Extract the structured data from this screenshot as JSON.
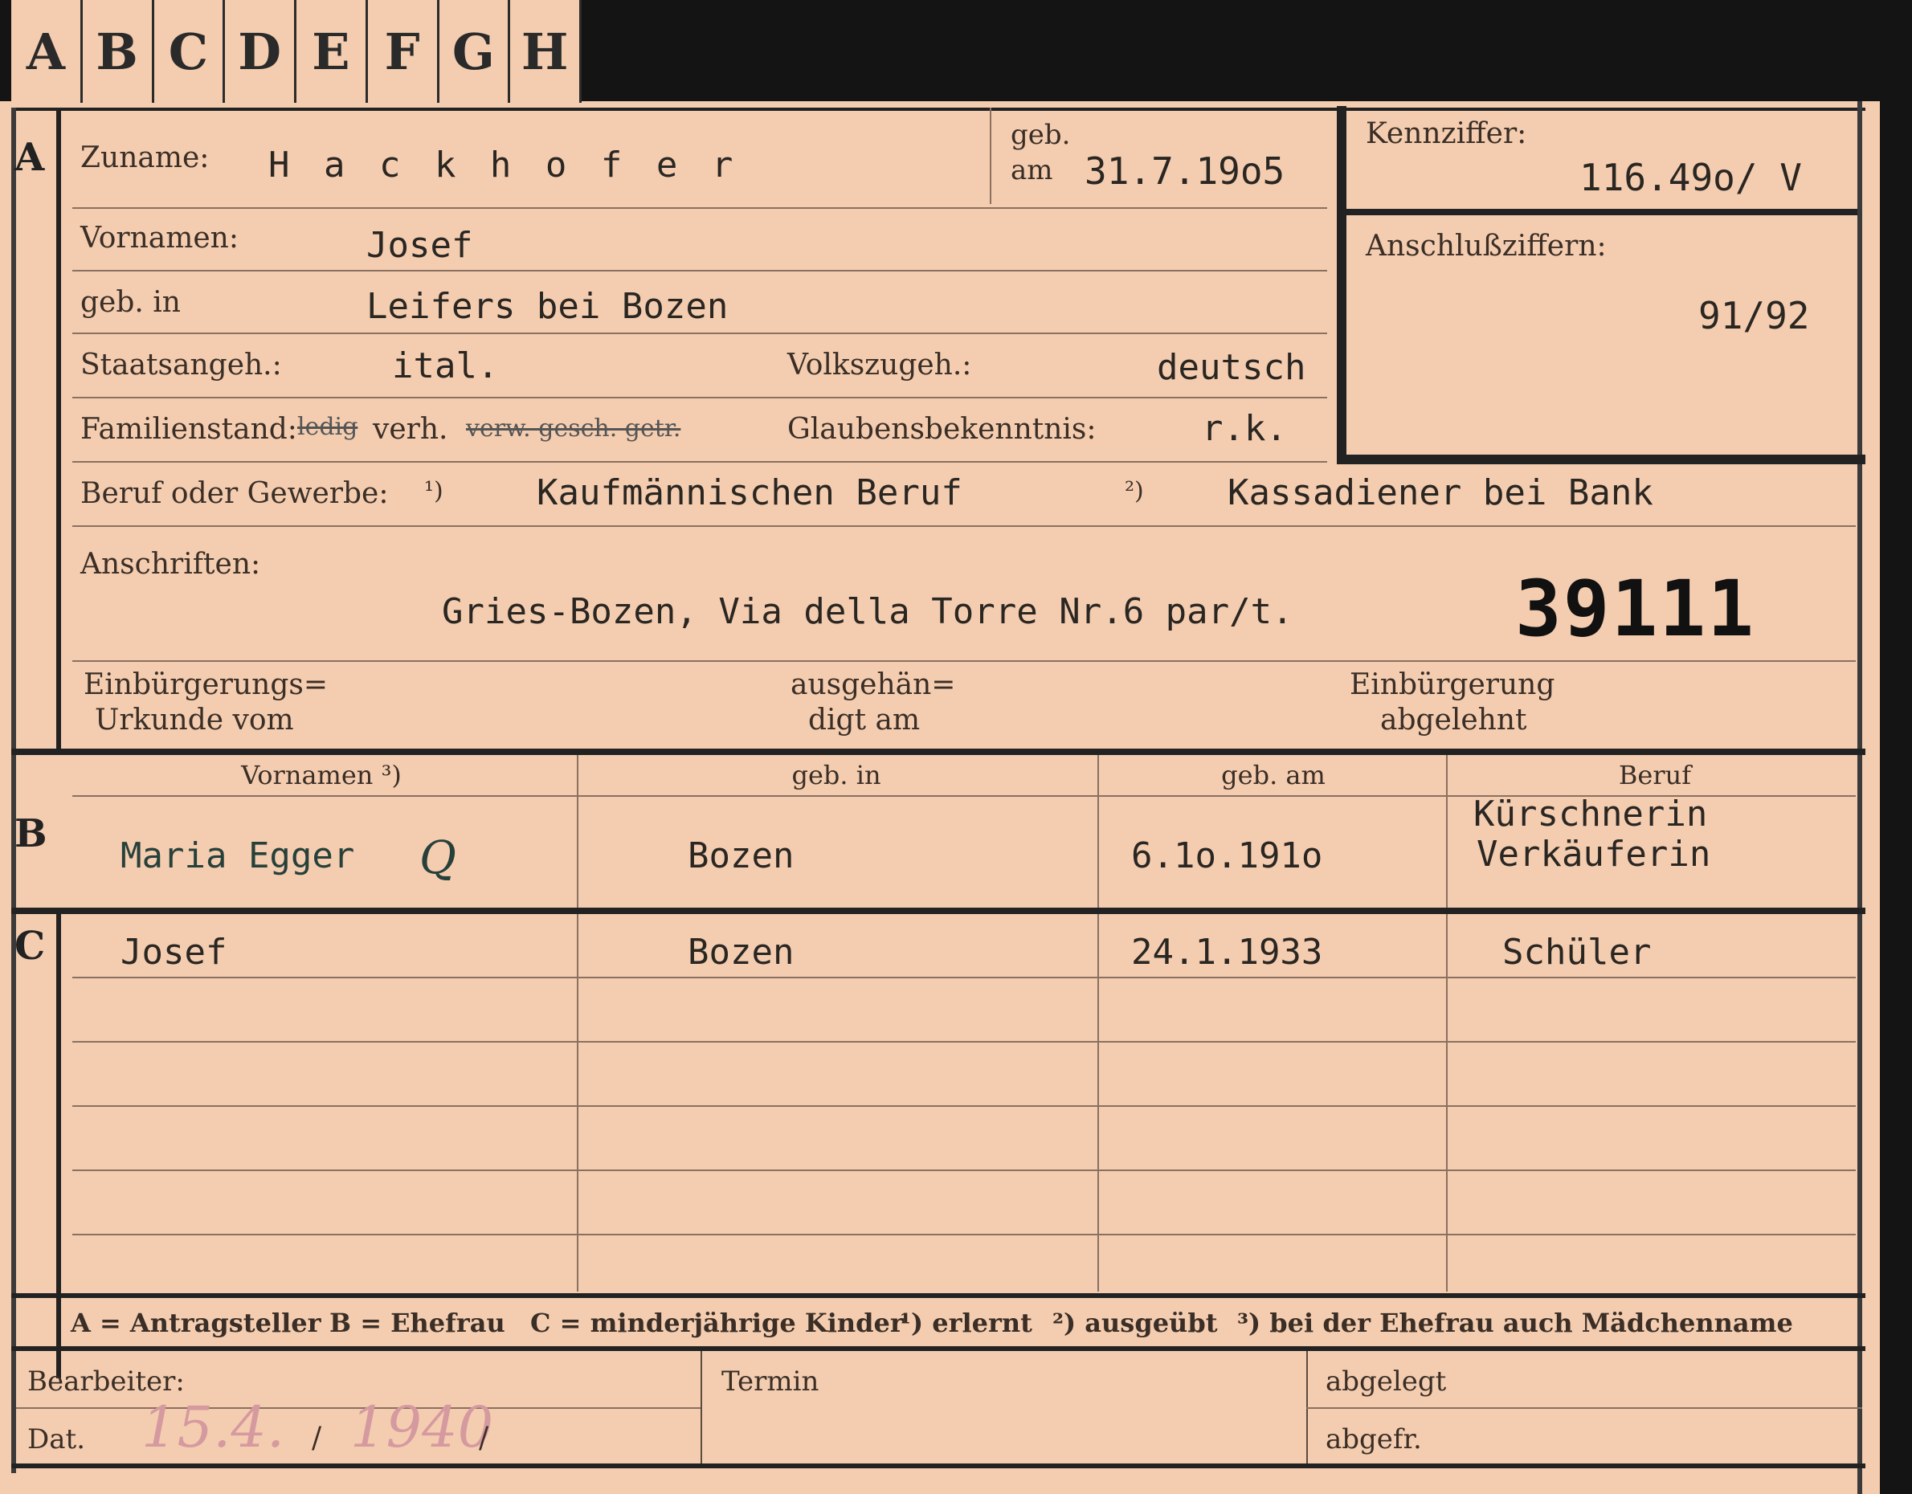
{
  "tabs": [
    "A",
    "B",
    "C",
    "D",
    "E",
    "F",
    "G",
    "H"
  ],
  "section_letters": {
    "a": "A",
    "b": "B",
    "c": "C"
  },
  "applicant": {
    "surname_label": "Zuname:",
    "surname": "H a c k h o f e r",
    "born_label_1": "geb.",
    "born_label_2": "am",
    "born_date": "31.7.19o5",
    "firstname_label": "Vornamen:",
    "firstname": "Josef",
    "birthplace_label": "geb. in",
    "birthplace": "Leifers  bei Bozen",
    "citizenship_label": "Staatsangeh.:",
    "citizenship": "ital.",
    "ethnicity_label": "Volkszugeh.:",
    "ethnicity": "deutsch",
    "marital_label": "Familienstand:",
    "marital_struck_1": "ledig",
    "marital_value": "verh.",
    "marital_struck_2": "verw. gesch. getr.",
    "religion_label": "Glaubensbekenntnis:",
    "religion": "r.k.",
    "profession_label": "Beruf oder Gewerbe:",
    "profession_note_1": "¹)",
    "profession_learned": "Kaufmännischen Beruf",
    "profession_note_2": "²)",
    "profession_practiced": "Kassadiener bei Bank",
    "address_label": "Anschriften:",
    "address": "Gries-Bozen, Via della Torre Nr.6 par/t.",
    "stamp_number": "39111",
    "naturalization_cert_label_1": "Einbürgerungs=",
    "naturalization_cert_label_2": "Urkunde vom",
    "handed_out_label_1": "ausgehän=",
    "handed_out_label_2": "digt am",
    "naturalization_refused_label_1": "Einbürgerung",
    "naturalization_refused_label_2": "abgelehnt"
  },
  "reference": {
    "id_label": "Kennziffer:",
    "id_value": "116.49o/ V",
    "connection_label": "Anschlußziffern:",
    "connection_value": "91/92"
  },
  "spouse_table": {
    "headers": [
      "Vornamen ³)",
      "geb. in",
      "geb. am",
      "Beruf"
    ],
    "name": "Maria Egger",
    "initial_mark": "Q",
    "birthplace": "Bozen",
    "birthdate": "6.1o.191o",
    "profession_line1": "Kürschnerin",
    "profession_line2": "Verkäuferin"
  },
  "children": [
    {
      "name": "Josef",
      "birthplace": "Bozen",
      "birthdate": "24.1.1933",
      "profession": "Schüler"
    }
  ],
  "legend": {
    "a": "A = Antragsteller",
    "b": "B = Ehefrau",
    "c": "C = minderjährige Kinder",
    "n1": "¹) erlernt",
    "n2": "²) ausgeübt",
    "n3": "³) bei der Ehefrau auch Mädchenname"
  },
  "footer": {
    "processor_label": "Bearbeiter:",
    "date_label": "Dat.",
    "date_day": "15.4.",
    "date_sep1": "/",
    "date_year": "1940",
    "date_sep2": "/",
    "deadline_label": "Termin",
    "filed_label": "abgelegt",
    "sent_label": "abgefr."
  }
}
